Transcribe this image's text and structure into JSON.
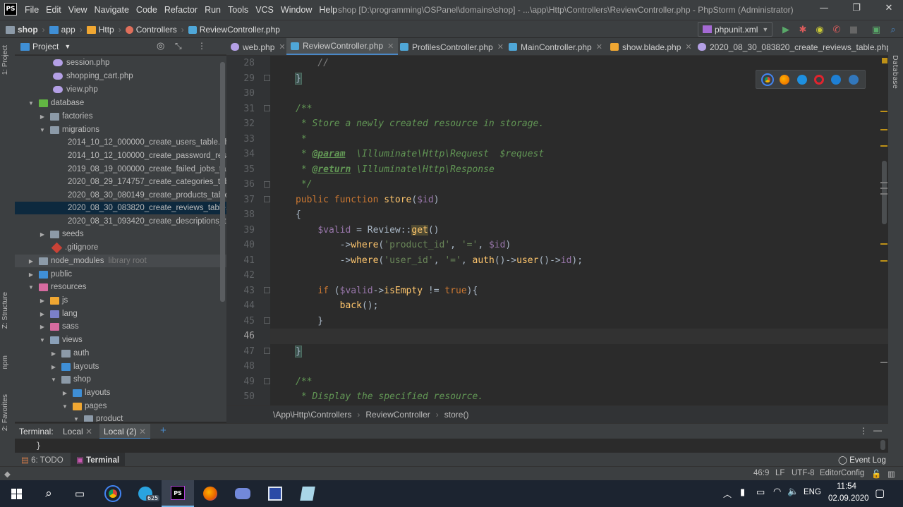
{
  "window": {
    "menu": [
      "File",
      "Edit",
      "View",
      "Navigate",
      "Code",
      "Refactor",
      "Run",
      "Tools",
      "VCS",
      "Window",
      "Help"
    ],
    "title": "shop [D:\\programming\\OSPanel\\domains\\shop] - ...\\app\\Http\\Controllers\\ReviewController.php - PhpStorm (Administrator)",
    "logo": "PS"
  },
  "navbar": {
    "crumbs": [
      "shop",
      "app",
      "Http",
      "Controllers",
      "ReviewController.php"
    ],
    "run_config": "phpunit.xml"
  },
  "left_strip": [
    "1: Project",
    "Z: Structure",
    "npm",
    "2: Favorites"
  ],
  "right_strip": [
    "Database"
  ],
  "project": {
    "header": "Project",
    "tree": [
      {
        "label": "session.php"
      },
      {
        "label": "shopping_cart.php"
      },
      {
        "label": "view.php"
      },
      {
        "label": "database"
      },
      {
        "label": "factories"
      },
      {
        "label": "migrations"
      },
      {
        "label": "2014_10_12_000000_create_users_table.php"
      },
      {
        "label": "2014_10_12_100000_create_password_resets"
      },
      {
        "label": "2019_08_19_000000_create_failed_jobs_table"
      },
      {
        "label": "2020_08_29_174757_create_categories_table"
      },
      {
        "label": "2020_08_30_080149_create_products_table.p"
      },
      {
        "label": "2020_08_30_083820_create_reviews_table.ph"
      },
      {
        "label": "2020_08_31_093420_create_descriptions_tab"
      },
      {
        "label": "seeds"
      },
      {
        "label": ".gitignore"
      },
      {
        "label": "node_modules",
        "extra": "library root"
      },
      {
        "label": "public"
      },
      {
        "label": "resources"
      },
      {
        "label": "js"
      },
      {
        "label": "lang"
      },
      {
        "label": "sass"
      },
      {
        "label": "views"
      },
      {
        "label": "auth"
      },
      {
        "label": "layouts"
      },
      {
        "label": "shop"
      },
      {
        "label": "layouts"
      },
      {
        "label": "pages"
      },
      {
        "label": "product"
      }
    ]
  },
  "tabs": [
    {
      "label": "web.php"
    },
    {
      "label": "ReviewController.php"
    },
    {
      "label": "ProfilesController.php"
    },
    {
      "label": "MainController.php"
    },
    {
      "label": "show.blade.php"
    },
    {
      "label": "2020_08_30_083820_create_reviews_table.php"
    }
  ],
  "editor": {
    "line_numbers": [
      "28",
      "29",
      "30",
      "31",
      "32",
      "33",
      "34",
      "35",
      "36",
      "37",
      "38",
      "39",
      "40",
      "41",
      "42",
      "43",
      "44",
      "45",
      "46",
      "47",
      "48",
      "49",
      "50"
    ],
    "current_line": "46"
  },
  "code_breadcrumbs": [
    "\\App\\Http\\Controllers",
    "ReviewController",
    "store()"
  ],
  "terminal": {
    "label": "Terminal:",
    "tabs": [
      "Local",
      "Local (2)"
    ],
    "add": "+",
    "output": "}"
  },
  "toolwindows": {
    "todo": "6: TODO",
    "terminal": "Terminal",
    "event_log": "Event Log"
  },
  "status": {
    "position": "46:9",
    "line_sep": "LF",
    "encoding": "UTF-8",
    "editorconfig": "EditorConfig"
  },
  "taskbar": {
    "lang": "ENG",
    "time": "11:54",
    "date": "02.09.2020",
    "telegram_badge": "625"
  }
}
